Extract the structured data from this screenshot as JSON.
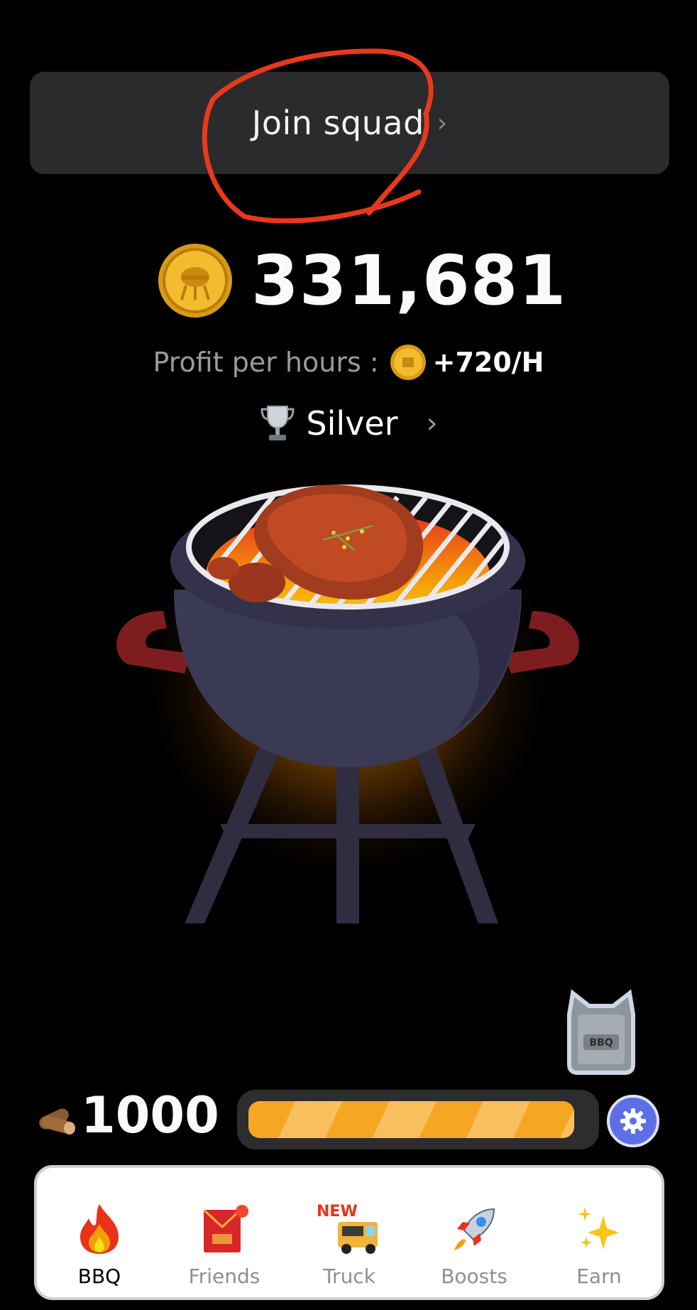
{
  "squad": {
    "label": "Join squad",
    "chevron": "›"
  },
  "balance": {
    "icon": "gold-coin-grill-icon",
    "value": "331,681"
  },
  "profit": {
    "label": "Profit per hours :",
    "icon": "small-coin-icon",
    "value": "+720/H"
  },
  "league": {
    "icon": "trophy-icon",
    "name": "Silver",
    "chevron": "›"
  },
  "grill": {
    "icon": "bbq-grill-illustration"
  },
  "chest": {
    "icon": "bbq-chest-icon",
    "label": "BBQ"
  },
  "energy": {
    "icon": "firewood-icon",
    "count": "1000",
    "fill_fraction": 0.96
  },
  "settings": {
    "icon": "gear-icon"
  },
  "nav": {
    "items": [
      {
        "label": "BBQ",
        "icon": "fire-icon",
        "active": true
      },
      {
        "label": "Friends",
        "icon": "red-envelope-icon",
        "badge": true
      },
      {
        "label": "Truck",
        "icon": "food-truck-icon",
        "badge_text": "NEW"
      },
      {
        "label": "Boosts",
        "icon": "rocket-icon"
      },
      {
        "label": "Earn",
        "icon": "sparkles-icon"
      }
    ]
  },
  "colors": {
    "background": "#000000",
    "card": "#2b2b2d",
    "energy": "#f5a623",
    "annotation": "#e8391d",
    "settings": "#5e6fe6"
  }
}
